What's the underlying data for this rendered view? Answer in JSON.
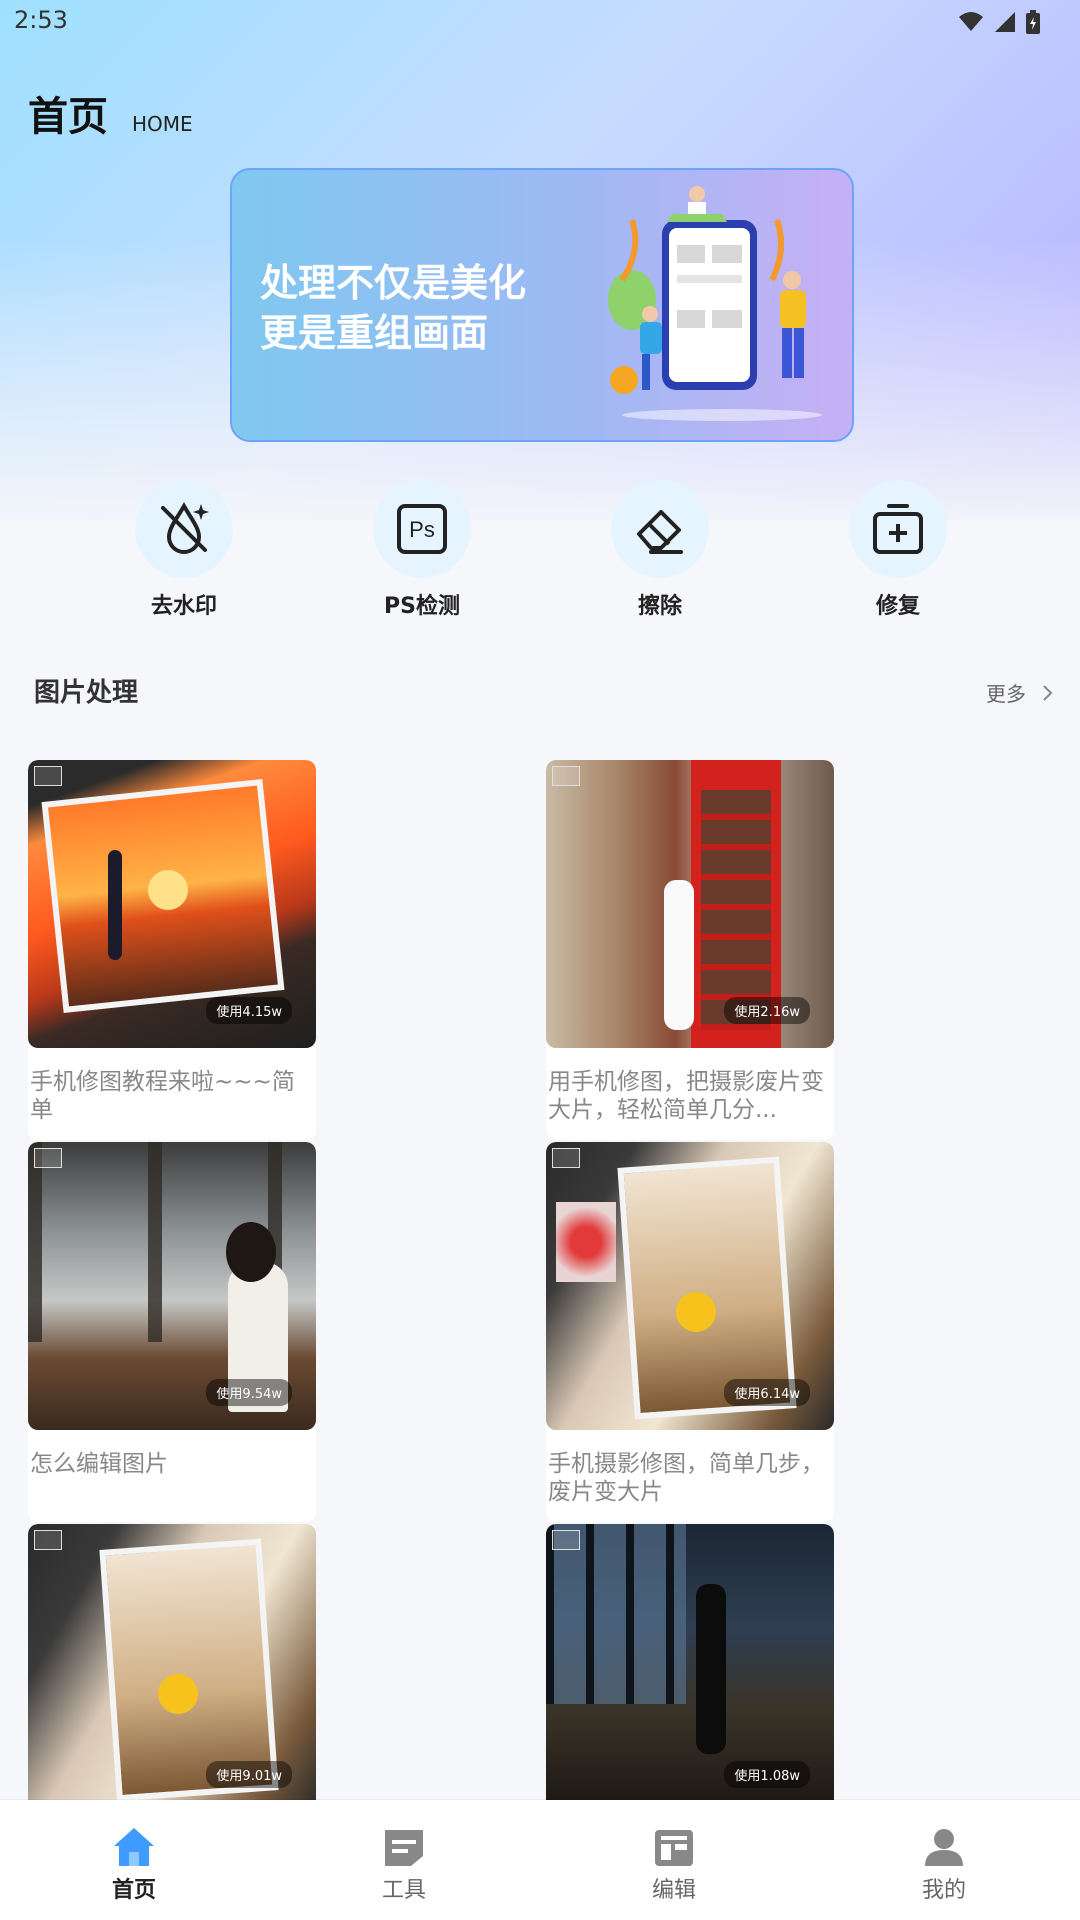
{
  "status_bar": {
    "time": "2:53"
  },
  "header": {
    "title": "首页",
    "subtitle": "HOME"
  },
  "banner": {
    "line1": "处理不仅是美化",
    "line2": "更是重组画面"
  },
  "quick_tools": [
    {
      "label": "去水印",
      "icon": "no-watermark-icon"
    },
    {
      "label": "PS检测",
      "icon": "ps-icon"
    },
    {
      "label": "擦除",
      "icon": "eraser-icon"
    },
    {
      "label": "修复",
      "icon": "repair-icon"
    }
  ],
  "section": {
    "title": "图片处理",
    "more": "更多"
  },
  "cards": [
    {
      "title": "手机修图教程来啦~~~简单",
      "usage": "使用4.15w"
    },
    {
      "title": "用手机修图，把摄影废片变大片，轻松简单几分...",
      "usage": "使用2.16w"
    },
    {
      "title": "怎么编辑图片",
      "usage": "使用9.54w"
    },
    {
      "title": "手机摄影修图，简单几步，废片变大片",
      "usage": "使用6.14w"
    },
    {
      "title": "",
      "usage": "使用9.01w"
    },
    {
      "title": "",
      "usage": "使用1.08w"
    }
  ],
  "bottom_nav": [
    {
      "label": "首页",
      "icon": "home-icon",
      "active": true
    },
    {
      "label": "工具",
      "icon": "tools-icon",
      "active": false
    },
    {
      "label": "编辑",
      "icon": "edit-layout-icon",
      "active": false
    },
    {
      "label": "我的",
      "icon": "profile-icon",
      "active": false
    }
  ],
  "colors": {
    "accent": "#3f9bff",
    "banner_border": "#6aa4ff",
    "icon_bg": "#e6f4ff"
  }
}
